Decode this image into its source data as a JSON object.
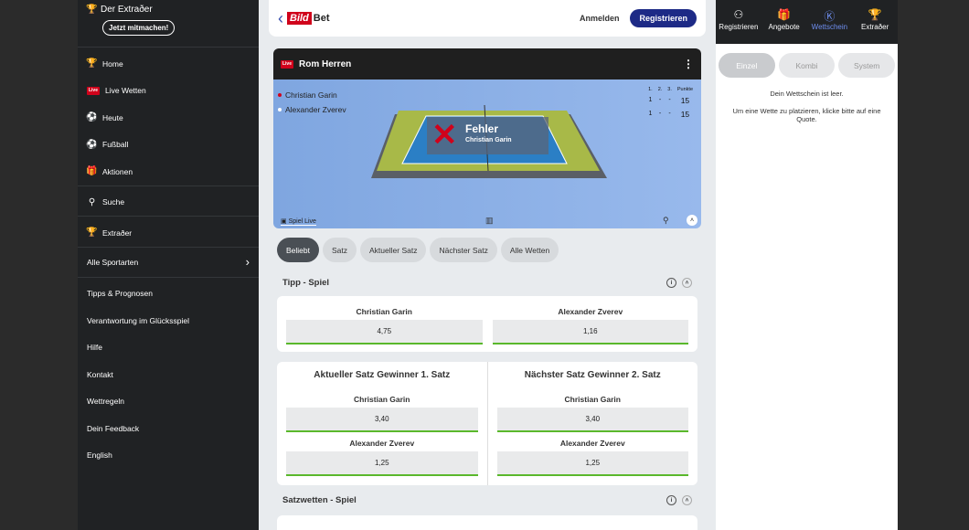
{
  "sidebar": {
    "brand": "Der Extraðer",
    "join": "Jetzt mitmachen!",
    "items": [
      {
        "icon": "trophy-icon",
        "label": "Home"
      },
      {
        "icon": "live-icon",
        "label": "Live Wetten",
        "badge": "Live"
      },
      {
        "icon": "soccer-ball-icon",
        "label": "Heute"
      },
      {
        "icon": "soccer-ball-icon",
        "label": "Fußball"
      },
      {
        "icon": "gift-icon",
        "label": "Aktionen"
      }
    ],
    "search": "Suche",
    "extra": "Extraðer",
    "all_sports": "Alle Sportarten",
    "links": [
      "Tipps & Prognosen",
      "Verantwortung im Glücksspiel",
      "Hilfe",
      "Kontakt",
      "Wettregeln",
      "Dein Feedback",
      "English"
    ]
  },
  "topbar": {
    "logo": "Bild",
    "logo_suffix": "Bet",
    "login": "Anmelden",
    "register": "Registrieren"
  },
  "match": {
    "live_badge": "Live",
    "title": "Rom Herren",
    "players": [
      {
        "name": "Christian Garin",
        "color": "#d0021b",
        "s1": "1",
        "s2": "-",
        "s3": "-",
        "points": "15"
      },
      {
        "name": "Alexander Zverev",
        "color": "#ffffff",
        "s1": "1",
        "s2": "-",
        "s3": "-",
        "points": "15"
      }
    ],
    "score_headers": [
      "1.",
      "2.",
      "3.",
      "Punkte"
    ],
    "event_title": "Fehler",
    "event_player": "Christian Garin",
    "spiel_live": "Spiel Live"
  },
  "tabs": [
    "Beliebt",
    "Satz",
    "Aktueller Satz",
    "Nächster Satz",
    "Alle Wetten"
  ],
  "tipp": {
    "title": "Tipp - Spiel",
    "options": [
      {
        "name": "Christian Garin",
        "odd": "4,75"
      },
      {
        "name": "Alexander Zverev",
        "odd": "1,16"
      }
    ]
  },
  "sets": [
    {
      "title": "Aktueller Satz Gewinner 1. Satz",
      "options": [
        {
          "name": "Christian Garin",
          "odd": "3,40"
        },
        {
          "name": "Alexander Zverev",
          "odd": "1,25"
        }
      ]
    },
    {
      "title": "Nächster Satz Gewinner 2. Satz",
      "options": [
        {
          "name": "Christian Garin",
          "odd": "3,40"
        },
        {
          "name": "Alexander Zverev",
          "odd": "1,25"
        }
      ]
    }
  ],
  "satzwetten": {
    "title": "Satzwetten - Spiel"
  },
  "right": {
    "tabs": [
      {
        "icon": "user-icon",
        "label": "Registrieren"
      },
      {
        "icon": "gift-icon",
        "label": "Angebote"
      },
      {
        "icon": "betslip-icon",
        "label": "Wettschein"
      },
      {
        "icon": "trophy-icon",
        "label": "Extraðer"
      }
    ],
    "bet_types": [
      "Einzel",
      "Kombi",
      "System"
    ],
    "empty": "Dein Wettschein ist leer.",
    "hint": "Um eine Wette zu platzieren, klicke bitte auf eine Quote."
  }
}
